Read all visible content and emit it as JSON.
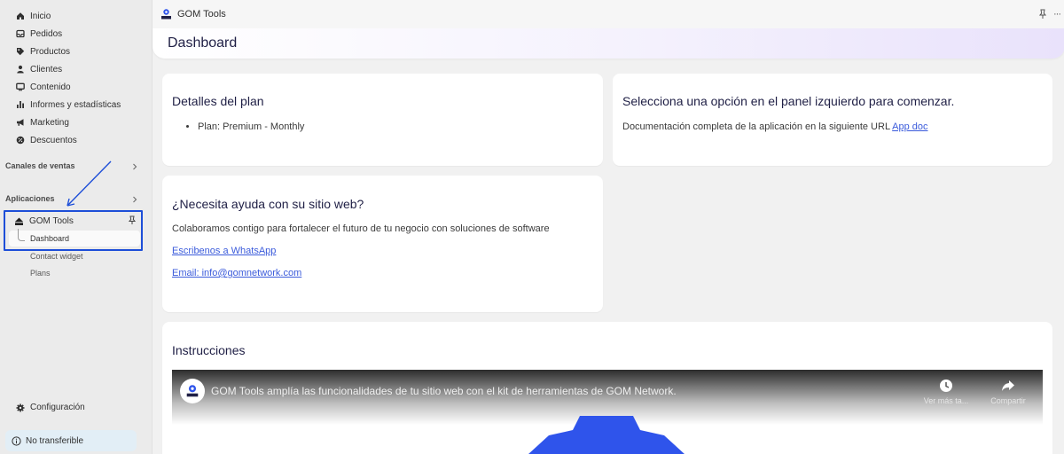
{
  "sidebar": {
    "items": [
      {
        "label": "Inicio",
        "icon": "home-icon"
      },
      {
        "label": "Pedidos",
        "icon": "inbox-icon"
      },
      {
        "label": "Productos",
        "icon": "tag-icon"
      },
      {
        "label": "Clientes",
        "icon": "person-icon"
      },
      {
        "label": "Contenido",
        "icon": "monitor-icon"
      },
      {
        "label": "Informes y estadísticas",
        "icon": "bar-chart-icon"
      },
      {
        "label": "Marketing",
        "icon": "megaphone-icon"
      },
      {
        "label": "Descuentos",
        "icon": "discount-icon"
      }
    ],
    "sales_channels_label": "Canales de ventas",
    "apps_label": "Aplicaciones",
    "app": {
      "name": "GOM Tools",
      "subitems": [
        {
          "label": "Dashboard",
          "active": true
        },
        {
          "label": "Contact widget",
          "active": false
        },
        {
          "label": "Plans",
          "active": false
        }
      ]
    },
    "settings_label": "Configuración",
    "nontransferable_label": "No transferible"
  },
  "topbar": {
    "app_title": "GOM Tools",
    "more_label": "···"
  },
  "page": {
    "title": "Dashboard"
  },
  "plan_card": {
    "title": "Detalles del plan",
    "plan_line": "Plan: Premium - Monthly"
  },
  "select_card": {
    "title": "Selecciona una opción en el panel izquierdo para comenzar.",
    "doc_text": "Documentación completa de la aplicación en la siguiente URL",
    "doc_link": "App doc"
  },
  "help_card": {
    "title": "¿Necesita ayuda con su sitio web?",
    "body": "Colaboramos contigo para fortalecer el futuro de tu negocio con soluciones de software",
    "whatsapp_link": "Escribenos a WhatsApp",
    "email_link": "Email: info@gomnetwork.com"
  },
  "instructions_card": {
    "title": "Instrucciones",
    "video": {
      "title": "GOM Tools amplía las funcionalidades de tu sitio web con el kit de herramientas de GOM Network.",
      "watch_later_label": "Ver más ta...",
      "share_label": "Compartir"
    }
  },
  "colors": {
    "highlight_box": "#1d4ed8",
    "link": "#3b5bdb",
    "title_text": "#1f1f45",
    "gear_blue": "#2f54eb"
  }
}
